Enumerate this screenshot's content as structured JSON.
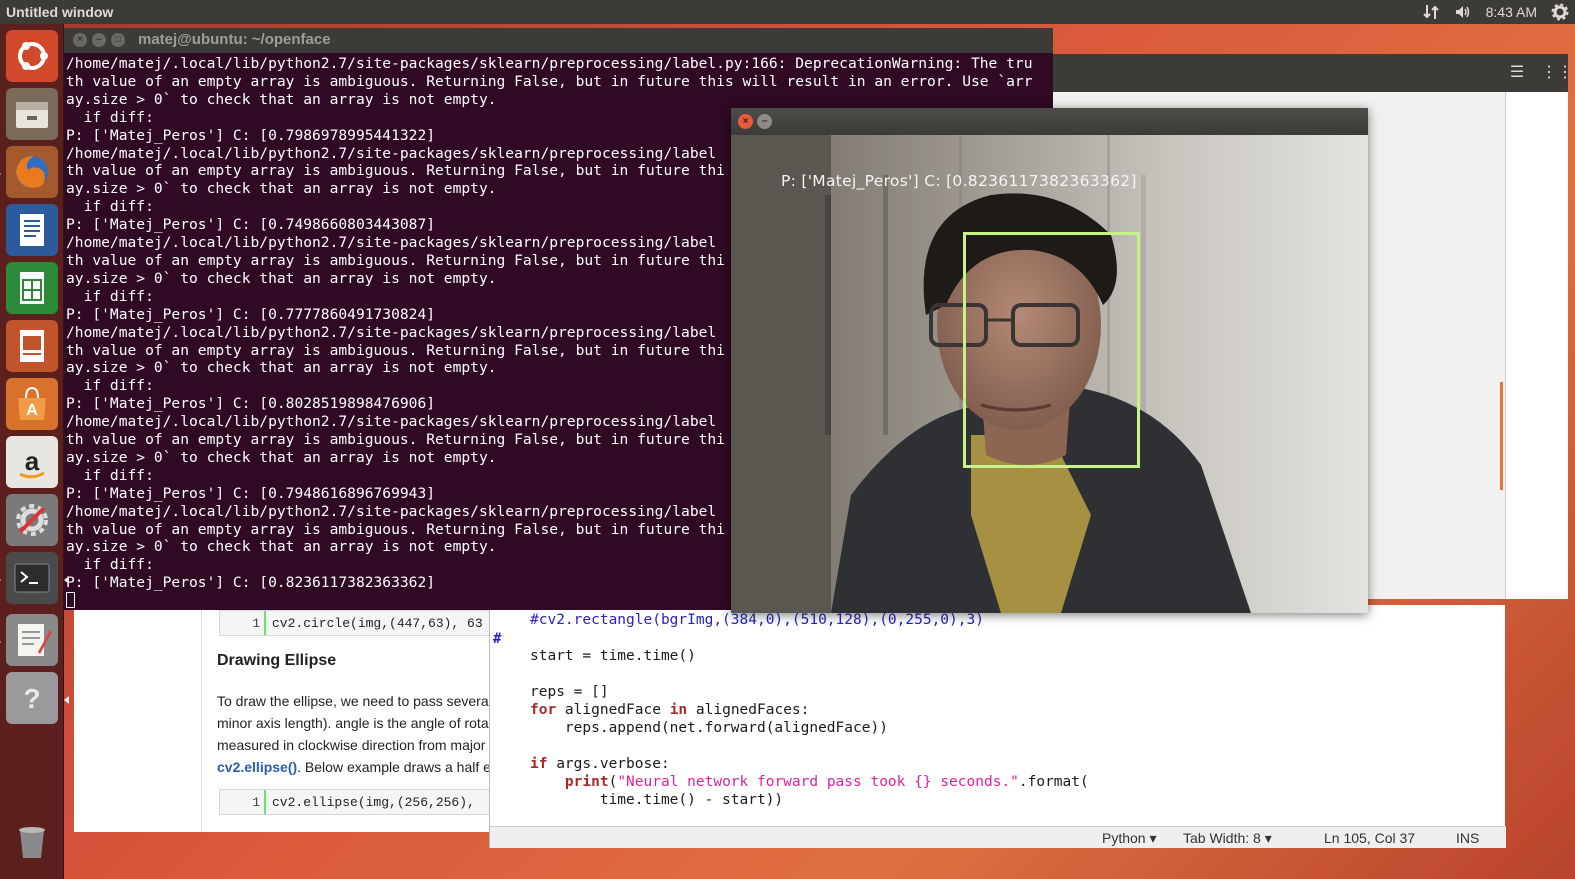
{
  "top_panel": {
    "window_title": "Untitled window",
    "clock": "8:43 AM",
    "icons": [
      "network-icon",
      "volume-icon",
      "gear-icon"
    ]
  },
  "launcher": {
    "items": [
      "ubuntu-dash-icon",
      "files-icon",
      "firefox-icon",
      "writer-icon",
      "calc-icon",
      "impress-icon",
      "software-center-icon",
      "amazon-icon",
      "system-settings-icon",
      "terminal-icon",
      "text-editor-icon",
      "help-icon",
      "trash-icon"
    ]
  },
  "terminal": {
    "title": "matej@ubuntu: ~/openface",
    "lines": [
      "/home/matej/.local/lib/python2.7/site-packages/sklearn/preprocessing/label.py:166: DeprecationWarning: The tru",
      "th value of an empty array is ambiguous. Returning False, but in future this will result in an error. Use `arr",
      "ay.size > 0` to check that an array is not empty.",
      "  if diff:",
      "P: ['Matej_Peros'] C: [0.7986978995441322]",
      "/home/matej/.local/lib/python2.7/site-packages/sklearn/preprocessing/label",
      "th value of an empty array is ambiguous. Returning False, but in future thi",
      "ay.size > 0` to check that an array is not empty.",
      "  if diff:",
      "P: ['Matej_Peros'] C: [0.7498660803443087]",
      "/home/matej/.local/lib/python2.7/site-packages/sklearn/preprocessing/label",
      "th value of an empty array is ambiguous. Returning False, but in future thi",
      "ay.size > 0` to check that an array is not empty.",
      "  if diff:",
      "P: ['Matej_Peros'] C: [0.7777860491730824]",
      "/home/matej/.local/lib/python2.7/site-packages/sklearn/preprocessing/label",
      "th value of an empty array is ambiguous. Returning False, but in future thi",
      "ay.size > 0` to check that an array is not empty.",
      "  if diff:",
      "P: ['Matej_Peros'] C: [0.8028519898476906]",
      "/home/matej/.local/lib/python2.7/site-packages/sklearn/preprocessing/label",
      "th value of an empty array is ambiguous. Returning False, but in future thi",
      "ay.size > 0` to check that an array is not empty.",
      "  if diff:",
      "P: ['Matej_Peros'] C: [0.7948616896769943]",
      "/home/matej/.local/lib/python2.7/site-packages/sklearn/preprocessing/label",
      "th value of an empty array is ambiguous. Returning False, but in future thi",
      "ay.size > 0` to check that an array is not empty.",
      "  if diff:",
      "P: ['Matej_Peros'] C: [0.8236117382363362]"
    ]
  },
  "webcam": {
    "overlay_label": "P: ['Matej_Peros'] C: [0.8236117382363362]",
    "box_color": "#c6f28a"
  },
  "tutorial": {
    "snippet1": {
      "line_no": "1",
      "code": "cv2.circle(img,(447,63), 63"
    },
    "heading": "Drawing Ellipse",
    "para_lines": [
      "To draw the ellipse, we need to pass several",
      "minor axis length). angle is the angle of rota",
      "measured in clockwise direction from major",
      "cv2.ellipse(). Below example draws a half e"
    ],
    "link": "cv2.ellipse()",
    "para_tail": ". Below example draws a half e",
    "snippet2": {
      "line_no": "1",
      "code": "cv2.ellipse(img,(256,256),"
    }
  },
  "editor": {
    "gutter_mark": "#",
    "code": {
      "l1": "#cv2.rectangle(bgrImg,(384,0),(510,128),(0,255,0),3)",
      "l2_a": "start = time.time()",
      "l3_a": "reps = []",
      "l4_kw1": "for",
      "l4_b": " alignedFace ",
      "l4_kw2": "in",
      "l4_c": " alignedFaces:",
      "l5": "    reps.append(net.forward(alignedFace))",
      "l6_kw": "if",
      "l6_b": " args.verbose:",
      "l7_kw": "print",
      "l7_b": "(",
      "l7_str": "\"Neural network forward pass took {} seconds.\"",
      "l7_c": ".format(",
      "l8": "        time.time() - start))"
    },
    "status": {
      "language": "Python ▾",
      "tab_width": "Tab Width: 8 ▾",
      "position": "Ln 105, Col 37",
      "mode": "INS"
    }
  }
}
